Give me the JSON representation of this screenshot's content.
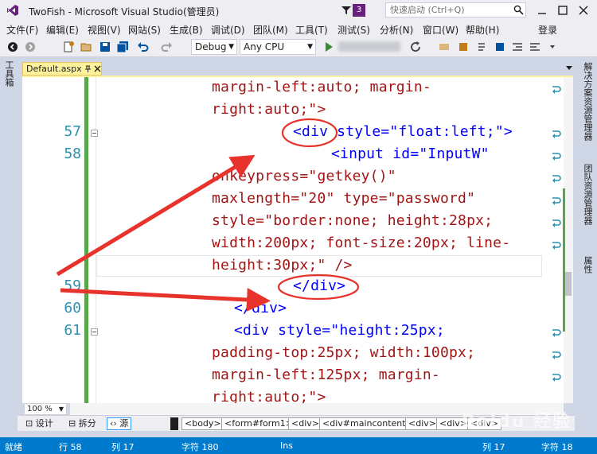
{
  "title_bar": {
    "title": "TwoFish - Microsoft Visual Studio(管理员)",
    "notification_count": "3",
    "quick_launch_placeholder": "快速启动 (Ctrl+Q)"
  },
  "menu": {
    "items": [
      "文件(F)",
      "编辑(E)",
      "视图(V)",
      "网站(S)",
      "生成(B)",
      "调试(D)",
      "团队(M)",
      "工具(T)",
      "测试(S)",
      "分析(N)",
      "窗口(W)",
      "帮助(H)"
    ],
    "login": "登录"
  },
  "toolbar": {
    "config": "Debug",
    "platform": "Any CPU"
  },
  "left_panel": {
    "toolbox_label": "工具箱"
  },
  "right_panel": {
    "tabs": [
      "解决方案资源管理器",
      "团队资源管理器",
      "属性"
    ]
  },
  "document": {
    "tab_name": "Default.aspx"
  },
  "editor": {
    "line_numbers": [
      "57",
      "58",
      "59",
      "60",
      "61"
    ],
    "code_lines": [
      "margin-left:auto; margin-",
      "right:auto;\">",
      "<div style=\"float:left;\">",
      "<input id=\"InputW\"",
      "onkeypress=\"getkey()\"",
      "maxlength=\"20\" type=\"password\"",
      "style=\"border:none; height:28px;",
      "width:200px; font-size:20px; line-",
      "height:30px;\" />",
      "</div>",
      "</div>",
      "<div style=\"height:25px;",
      "padding-top:25px; width:100px;",
      "margin-left:125px; margin-",
      "right:auto;\">"
    ]
  },
  "zoom": "100 %",
  "view_bar": {
    "design": "设计",
    "split": "拆分",
    "source": "源",
    "breadcrumbs": [
      "<body>",
      "<form#form1>",
      "<div>",
      "<div#maincontent>",
      "<div>",
      "<div>",
      "<div>"
    ]
  },
  "status_bar": {
    "ready": "就绪",
    "line": "行 58",
    "col": "列 17",
    "char": "字符 180",
    "mode": "Ins",
    "col2": "列 17",
    "char2": "字符 18"
  },
  "watermark": "Baidu 经验",
  "colors": {
    "accent": "#007acc",
    "tab_active": "#fff29d",
    "annotation": "#e8322c",
    "change_bar": "#57a64a"
  }
}
